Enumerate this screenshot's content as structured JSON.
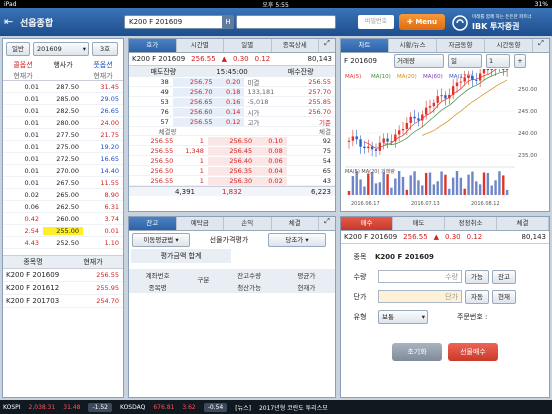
{
  "status": {
    "device": "iPad",
    "time": "오후 5:55",
    "battery": "31%"
  },
  "app": {
    "title": "선옵종합",
    "code": "K200 F 201609",
    "h_label": "H",
    "pw_placeholder": "비밀번호",
    "menu_label": "Menu",
    "brand_small": "미래를 함께 하는 든든한 파트너",
    "brand": "IBK 투자증권"
  },
  "left": {
    "tab_general": "일반",
    "code": "201609",
    "tab_3": "3호",
    "col_call": "콜옵션",
    "col_strike": "행사가",
    "col_put": "풋옵션",
    "col_price": "현재가",
    "col_price2": "현재가",
    "rows": [
      {
        "call": "0.01",
        "strike": "287.50",
        "put": "31.45",
        "pc": "red"
      },
      {
        "call": "0.01",
        "strike": "285.00",
        "put": "29.05",
        "pc": "blue"
      },
      {
        "call": "0.01",
        "strike": "282.50",
        "put": "26.65",
        "pc": "blue"
      },
      {
        "call": "0.01",
        "strike": "280.00",
        "put": "24.00",
        "pc": "red"
      },
      {
        "call": "0.01",
        "strike": "277.50",
        "put": "21.75",
        "pc": "red"
      },
      {
        "call": "0.01",
        "strike": "275.00",
        "put": "19.20",
        "pc": "blue"
      },
      {
        "call": "0.01",
        "strike": "272.50",
        "put": "16.65",
        "pc": "blue"
      },
      {
        "call": "0.01",
        "strike": "270.00",
        "put": "14.40",
        "pc": "blue"
      },
      {
        "call": "0.01",
        "strike": "267.50",
        "put": "11.55",
        "pc": "red"
      },
      {
        "call": "0.02",
        "strike": "265.00",
        "put": "8.90",
        "pc": "red"
      },
      {
        "call": "0.06",
        "strike": "262.50",
        "put": "6.31",
        "pc": "red"
      },
      {
        "call": "0.42",
        "strike": "260.00",
        "put": "3.74",
        "pc": "red"
      },
      {
        "call": "2.54",
        "strike": "255.00",
        "put": "0.01",
        "pc": "red",
        "atm": true
      },
      {
        "call": "4.43",
        "strike": "252.50",
        "put": "1.10",
        "pc": "red"
      }
    ],
    "list_hdr_name": "종목명",
    "list_hdr_price": "현재가",
    "list": [
      {
        "name": "K200 F 201609",
        "price": "256.55"
      },
      {
        "name": "K200 F 201612",
        "price": "255.95"
      },
      {
        "name": "K200 F 201703",
        "price": "254.70"
      }
    ]
  },
  "quote": {
    "tabs": [
      "호가",
      "시간별",
      "일별",
      "종목상세"
    ],
    "code": "K200 F 201609",
    "price": "256.55",
    "arrow": "▲",
    "chg": "0.30",
    "pct": "0.12",
    "vol": "80,143",
    "hdr_sell": "매도잔량",
    "time": "15:45:00",
    "hdr_buy": "매수잔량",
    "asks": [
      {
        "q": "38",
        "p": "256.75",
        "r": "0.20",
        "info": "미결"
      },
      {
        "q": "49",
        "p": "256.70",
        "r": "0.18",
        "info": "133,181"
      },
      {
        "q": "53",
        "p": "256.65",
        "r": "0.16",
        "info": "-5,018"
      },
      {
        "q": "76",
        "p": "256.60",
        "r": "0.14",
        "info": "시가"
      },
      {
        "q": "57",
        "p": "256.55",
        "r": "0.12",
        "info": "고가"
      }
    ],
    "ask_side": [
      "256.55",
      "257.70",
      "255.85",
      "256.70",
      "기준"
    ],
    "bids": [
      {
        "p": "256.50",
        "r": "0.10",
        "q": "92"
      },
      {
        "p": "256.45",
        "r": "0.08",
        "q": "75"
      },
      {
        "p": "256.40",
        "r": "0.06",
        "q": "54"
      },
      {
        "p": "256.35",
        "r": "0.04",
        "q": "65"
      },
      {
        "p": "256.30",
        "r": "0.02",
        "q": "43"
      }
    ],
    "bid_side_label": "체결",
    "ticks": [
      {
        "p": "256.55",
        "q": "1"
      },
      {
        "p": "256.55",
        "q": "1,348"
      },
      {
        "p": "256.50",
        "q": "1"
      },
      {
        "p": "256.50",
        "q": "1"
      },
      {
        "p": "256.55",
        "q": "1"
      }
    ],
    "tick_hdr": "체결량",
    "tot_sell": "4,391",
    "tot_mid": "1,832",
    "tot_buy": "6,223"
  },
  "balance": {
    "tabs": [
      "잔고",
      "예탁금",
      "손익",
      "체결"
    ],
    "eval_label": "이동평균법",
    "mid_label": "선물가격평가",
    "dropdown": "당초가",
    "summary_label": "평가금액 합계",
    "hdr": [
      "계좌번호",
      "구분",
      "잔고수량",
      "평균가",
      "종목명",
      "청산가능",
      "현재가"
    ]
  },
  "chart": {
    "tabs": [
      "차트",
      "시황/뉴스",
      "자금동향",
      "시간동향"
    ],
    "code": "F 201609",
    "type_sel": "거래량",
    "period_sel": "일",
    "count_sel": "1",
    "ma_labels": [
      "MA(5)",
      "MA(10)",
      "MA(20)",
      "MA(60)",
      "MA(120)"
    ],
    "y_ticks": [
      "250.00",
      "245.00",
      "240.00",
      "235.00"
    ],
    "vol_label": "MA(5) MA(20) 거래량",
    "x_ticks": [
      "2016.06.17",
      "2016.07.13",
      "2016.08.12"
    ]
  },
  "order": {
    "tabs": [
      "매수",
      "매도",
      "정정취소",
      "체결"
    ],
    "code": "K200 F 201609",
    "price": "256.55",
    "arrow": "▲",
    "chg": "0.30",
    "pct": "0.12",
    "vol": "80,143",
    "label_item": "종목",
    "item_val": "K200 F 201609",
    "label_qty": "수량",
    "qty_placeholder": "수량",
    "btn_avail": "가능",
    "btn_bal": "잔고",
    "label_price": "단가",
    "price_placeholder": "단가",
    "btn_auto": "자동",
    "btn_cur": "현재",
    "label_type": "유형",
    "type_val": "보통",
    "label_order_no": "주문번호 :",
    "btn_reset": "초기화",
    "btn_buy": "선물매수"
  },
  "taskbar": {
    "kospi_label": "KOSPI",
    "kospi_val": "2,038.31",
    "kospi_chg": "31.48",
    "kospi_pct": "-1.52",
    "kosdaq_label": "KOSDAQ",
    "kosdaq_val": "676.81",
    "kosdaq_chg": "3.62",
    "kosdaq_pct": "-0.54",
    "news_label": "[뉴스]",
    "news": "2017년형 코란도 투리스모"
  }
}
